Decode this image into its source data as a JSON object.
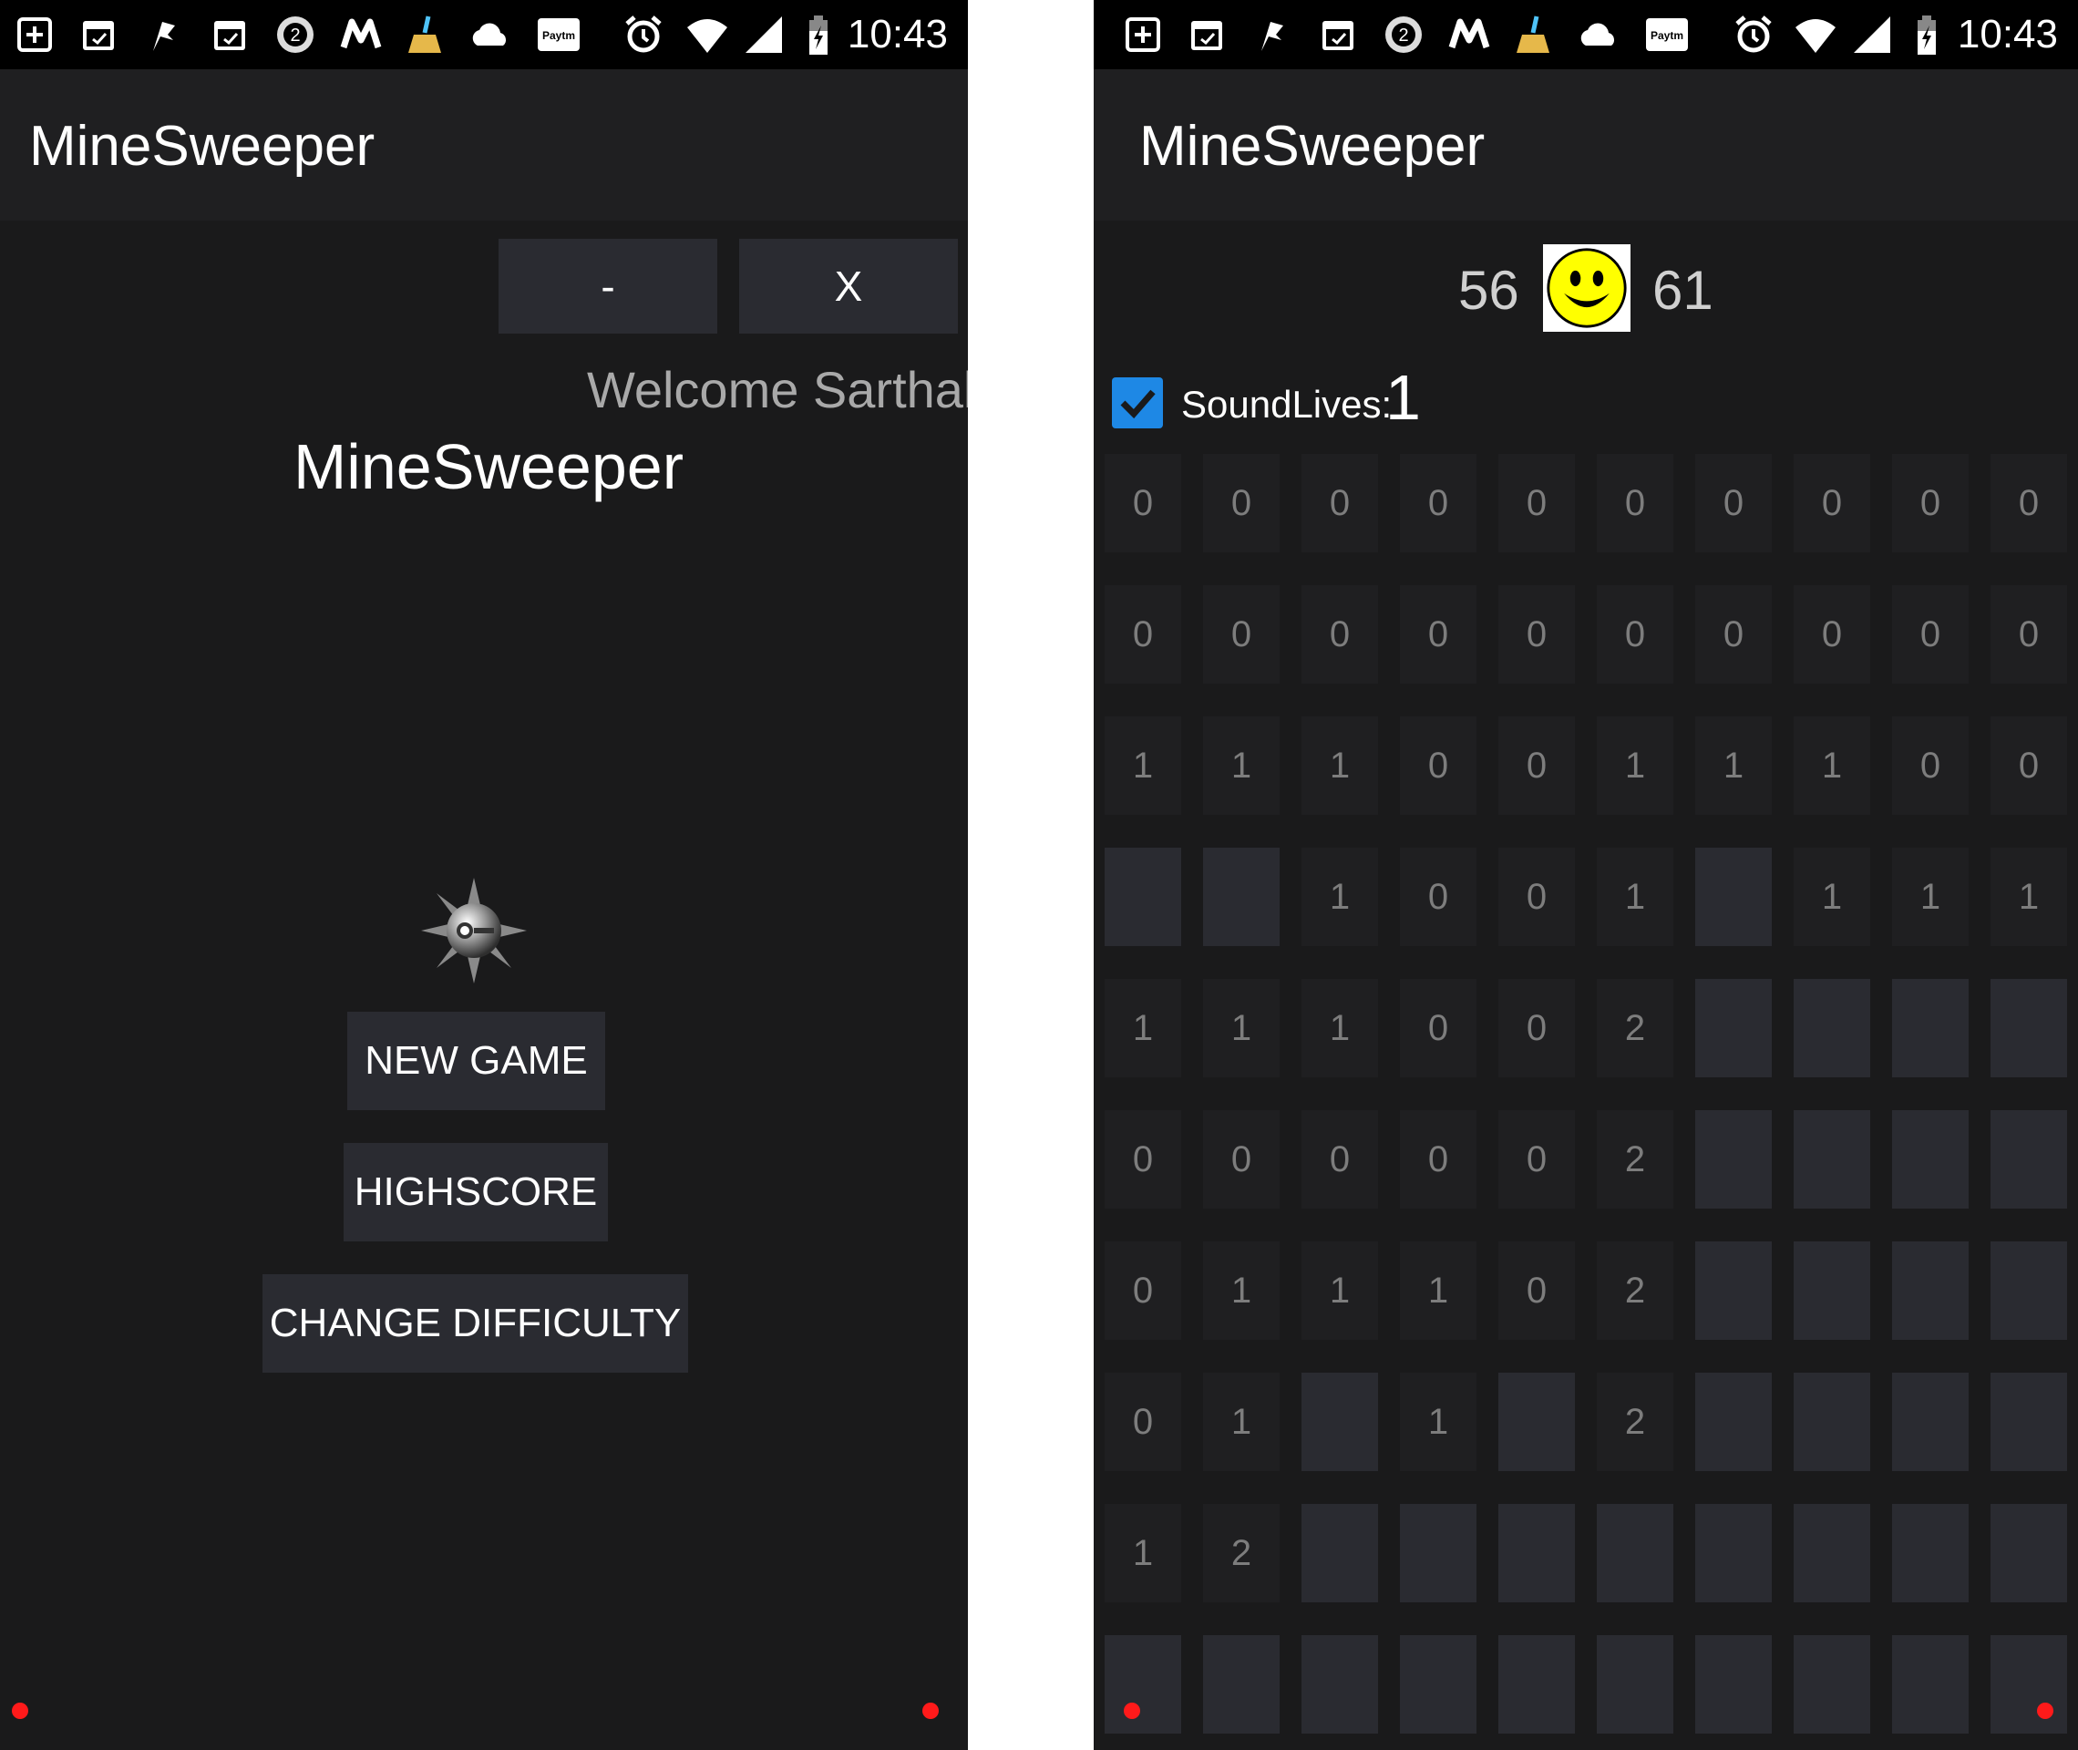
{
  "status_bar": {
    "time": "10:43",
    "icons": [
      "add-box-icon",
      "calendar-icon",
      "flag-icon",
      "calendar-icon",
      "badge-2-icon",
      "m-icon",
      "broom-icon",
      "cloud-icon",
      "paytm-icon",
      "alarm-icon",
      "wifi-icon",
      "signal-icon",
      "battery-icon"
    ],
    "badge_number": "2",
    "paytm_text": "Paytm"
  },
  "home": {
    "app_title": "MineSweeper",
    "minimize_label": "-",
    "close_label": "X",
    "welcome_text": "Welcome Sarthak",
    "title": "MineSweeper",
    "new_game_label": "NEW GAME",
    "highscore_label": "HIGHSCORE",
    "change_difficulty_label": "CHANGE DIFFICULTY"
  },
  "game": {
    "app_title": "MineSweeper",
    "left_counter": "56",
    "right_counter": "61",
    "sound_label": "Sound",
    "sound_checked": true,
    "lives_label": "Lives:",
    "lives_value": "1",
    "board": [
      [
        "0",
        "0",
        "0",
        "0",
        "0",
        "0",
        "0",
        "0",
        "0",
        "0"
      ],
      [
        "0",
        "0",
        "0",
        "0",
        "0",
        "0",
        "0",
        "0",
        "0",
        "0"
      ],
      [
        "1",
        "1",
        "1",
        "0",
        "0",
        "1",
        "1",
        "1",
        "0",
        "0"
      ],
      [
        "",
        "",
        "1",
        "0",
        "0",
        "1",
        "",
        "1",
        "1",
        "1"
      ],
      [
        "1",
        "1",
        "1",
        "0",
        "0",
        "2",
        "",
        "",
        "",
        ""
      ],
      [
        "0",
        "0",
        "0",
        "0",
        "0",
        "2",
        "",
        "",
        "",
        ""
      ],
      [
        "0",
        "1",
        "1",
        "1",
        "0",
        "2",
        "",
        "",
        "",
        ""
      ],
      [
        "0",
        "1",
        "",
        "1",
        "",
        "2",
        "",
        "",
        "",
        ""
      ],
      [
        "1",
        "2",
        "",
        "",
        "",
        "",
        "",
        "",
        "",
        ""
      ],
      [
        "",
        "",
        "",
        "",
        "",
        "",
        "",
        "",
        "",
        ""
      ]
    ]
  },
  "colors": {
    "background": "#1a1a1b",
    "appbar": "#1f1f21",
    "button": "#2a2b31",
    "checkbox": "#1e88e5",
    "dot": "#ff1a1a",
    "smiley": "#ffff00"
  }
}
